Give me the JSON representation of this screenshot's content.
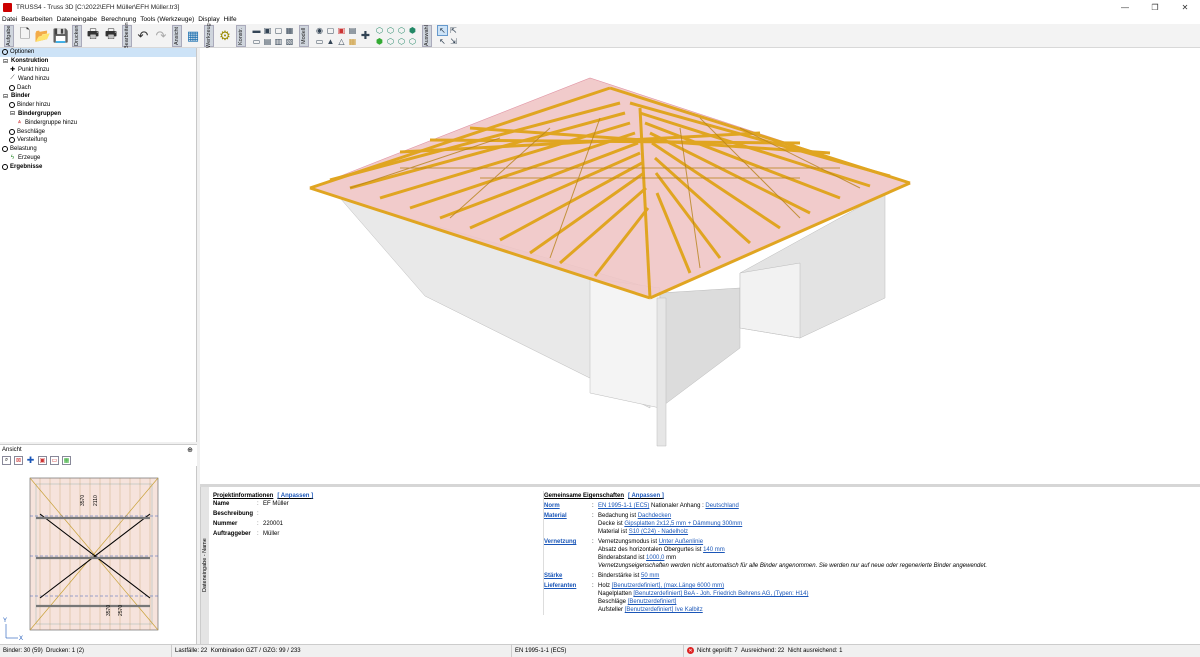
{
  "window": {
    "title": "TRUSS4 - Truss 3D [C:\\2022\\EFH Müller\\EFH Müller.tr3]",
    "controls": [
      "—",
      "❐",
      "✕"
    ]
  },
  "menu": [
    "Datei",
    "Bearbeiten",
    "Dateneingabe",
    "Berechnung",
    "Tools (Werkzeuge)",
    "Display",
    "Hilfe"
  ],
  "toolbar": {
    "tabs": [
      "Aufgabe",
      "Drucken",
      "Bearbeiten",
      "Ansicht",
      "Werkzeug",
      "Konstr.",
      "Modell",
      "Auswahl"
    ]
  },
  "tree": {
    "items": [
      {
        "label": "Optionen",
        "level": 0,
        "bold": false,
        "icon": "ring-icon",
        "selected": true
      },
      {
        "label": "Konstruktion",
        "level": 0,
        "bold": true,
        "icon": "box-icon"
      },
      {
        "label": "Punkt hinzu",
        "level": 1,
        "bold": false,
        "icon": "plus-icon"
      },
      {
        "label": "Wand hinzu",
        "level": 1,
        "bold": false,
        "icon": "line-icon"
      },
      {
        "label": "Dach",
        "level": 1,
        "bold": false,
        "icon": "ring-icon"
      },
      {
        "label": "Binder",
        "level": 0,
        "bold": true,
        "icon": "box-icon"
      },
      {
        "label": "Binder hinzu",
        "level": 1,
        "bold": false,
        "icon": "ring-icon"
      },
      {
        "label": "Bindergruppen",
        "level": 1,
        "bold": true,
        "icon": "box-icon"
      },
      {
        "label": "Bindergruppe hinzu",
        "level": 2,
        "bold": false,
        "icon": "truss-icon"
      },
      {
        "label": "Beschläge",
        "level": 1,
        "bold": false,
        "icon": "ring-icon"
      },
      {
        "label": "Versteifung",
        "level": 1,
        "bold": false,
        "icon": "ring-icon"
      },
      {
        "label": "Belastung",
        "level": 0,
        "bold": false,
        "icon": "ring-icon"
      },
      {
        "label": "Erzeuge",
        "level": 1,
        "bold": false,
        "icon": "lightning-icon"
      },
      {
        "label": "Ergebnisse",
        "level": 0,
        "bold": true,
        "icon": "ring-icon"
      }
    ]
  },
  "viewpanel": {
    "title": "Ansicht"
  },
  "info_tab": "Dateneingabe - Name",
  "projekt": {
    "title": "Projektinformationen",
    "adjust": "[ Anpassen ]",
    "rows": [
      {
        "k": "Name",
        "v": "EF Müller"
      },
      {
        "k": "Beschreibung",
        "v": ""
      },
      {
        "k": "Nummer",
        "v": "220001"
      },
      {
        "k": "Auftraggeber",
        "v": "Müller"
      }
    ]
  },
  "gemeinsam": {
    "title": "Gemeinsame Eigenschaften",
    "adjust": "[ Anpassen ]",
    "norm": {
      "k": "Norm",
      "link": "EN 1995-1-1 (EC5)",
      "mid": "Nationaler Anhang :",
      "link2": "Deutschland"
    },
    "material": {
      "k": "Material",
      "l1_pre": "Bedachung ist",
      "l1_link": "Dachdecken",
      "l2_pre": "Decke ist",
      "l2_link": "Gipsplatten 2x12,5 mm + Dämmung 300mm",
      "l3_pre": "Material ist",
      "l3_link": "S10 (C24) - Nadelholz"
    },
    "vernetzung": {
      "k": "Vernetzung",
      "l1_pre": "Vernetzungsmodus ist",
      "l1_link": "Unter Außenlinie",
      "l2_pre": "Absatz des horizontalen Obergurtes ist",
      "l2_link": "140 mm",
      "l3_pre": "Binderabstand ist",
      "l3_link": "1000,0",
      "l3_post": "mm",
      "l4": "Vernetzungseigenschaften werden nicht automatisch für alle Binder angenommen. Sie werden nur auf neue oder regenerierte Binder angewendet."
    },
    "staerke": {
      "k": "Stärke",
      "pre": "Binderstärke ist",
      "link": "50 mm"
    },
    "lieferanten": {
      "k": "Lieferanten",
      "l1_pre": "Holz",
      "l1_link": "[Benutzerdefiniert], (max.Länge 6000 mm)",
      "l2_pre": "Nagelplatten",
      "l2_link": "[Benutzerdefiniert] BeA - Joh. Friedrich Behrens AG, (Typen: H14)",
      "l3_pre": "Beschläge",
      "l3_link": "[Benutzerdefiniert]",
      "l4_pre": "Aufsteller",
      "l4_link": "[Benutzerdefiniert] Ive Kalbitz"
    }
  },
  "status": {
    "binder": "Binder: 30 (59)",
    "drucken": "Drucken: 1 (2)",
    "lastfaelle": "Lastfälle: 22",
    "kombination": "Kombination GZT / GZG: 99 / 233",
    "norm": "EN 1995-1-1 (EC5)",
    "nicht_geprueft": "Nicht geprüft: 7",
    "ausreichend": "Ausreichend: 22",
    "nicht_ausreichend": "Nicht ausreichend: 1"
  },
  "drawing_labels": {
    "dim1": "3570",
    "dim2": "2110",
    "dim3": "3570",
    "dim4": "2570",
    "axis_x": "X",
    "axis_y": "Y"
  }
}
